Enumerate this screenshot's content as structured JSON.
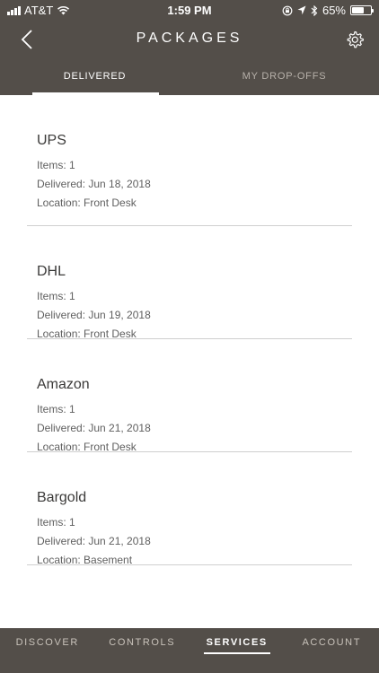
{
  "status_bar": {
    "carrier": "AT&T",
    "time": "1:59 PM",
    "battery_percent": "65%",
    "battery_level": 0.65,
    "icons": [
      "signal-icon",
      "wifi-icon",
      "lock-rotation-icon",
      "location-icon",
      "bluetooth-icon",
      "battery-icon"
    ]
  },
  "navbar": {
    "title": "PACKAGES",
    "back_icon": "chevron-left-icon",
    "settings_icon": "gear-icon"
  },
  "tabs": [
    {
      "label": "DELIVERED",
      "active": true
    },
    {
      "label": "MY DROP-OFFS",
      "active": false
    }
  ],
  "packages": [
    {
      "carrier": "UPS",
      "items": "Items: 1",
      "delivered": "Delivered: Jun 18, 2018",
      "location": "Location: Front Desk"
    },
    {
      "carrier": "DHL",
      "items": "Items: 1",
      "delivered": "Delivered: Jun 19, 2018",
      "location": "Location: Front Desk"
    },
    {
      "carrier": "Amazon",
      "items": "Items: 1",
      "delivered": "Delivered: Jun 21, 2018",
      "location": "Location: Front Desk"
    },
    {
      "carrier": "Bargold",
      "items": "Items: 1",
      "delivered": "Delivered: Jun 21, 2018",
      "location": "Location: Basement"
    }
  ],
  "bottom_nav": [
    {
      "label": "DISCOVER",
      "active": false
    },
    {
      "label": "CONTROLS",
      "active": false
    },
    {
      "label": "SERVICES",
      "active": true
    },
    {
      "label": "ACCOUNT",
      "active": false
    }
  ],
  "colors": {
    "header_bg": "#534e49",
    "text_dark": "#3b3a39",
    "divider": "#cfcfcf"
  }
}
